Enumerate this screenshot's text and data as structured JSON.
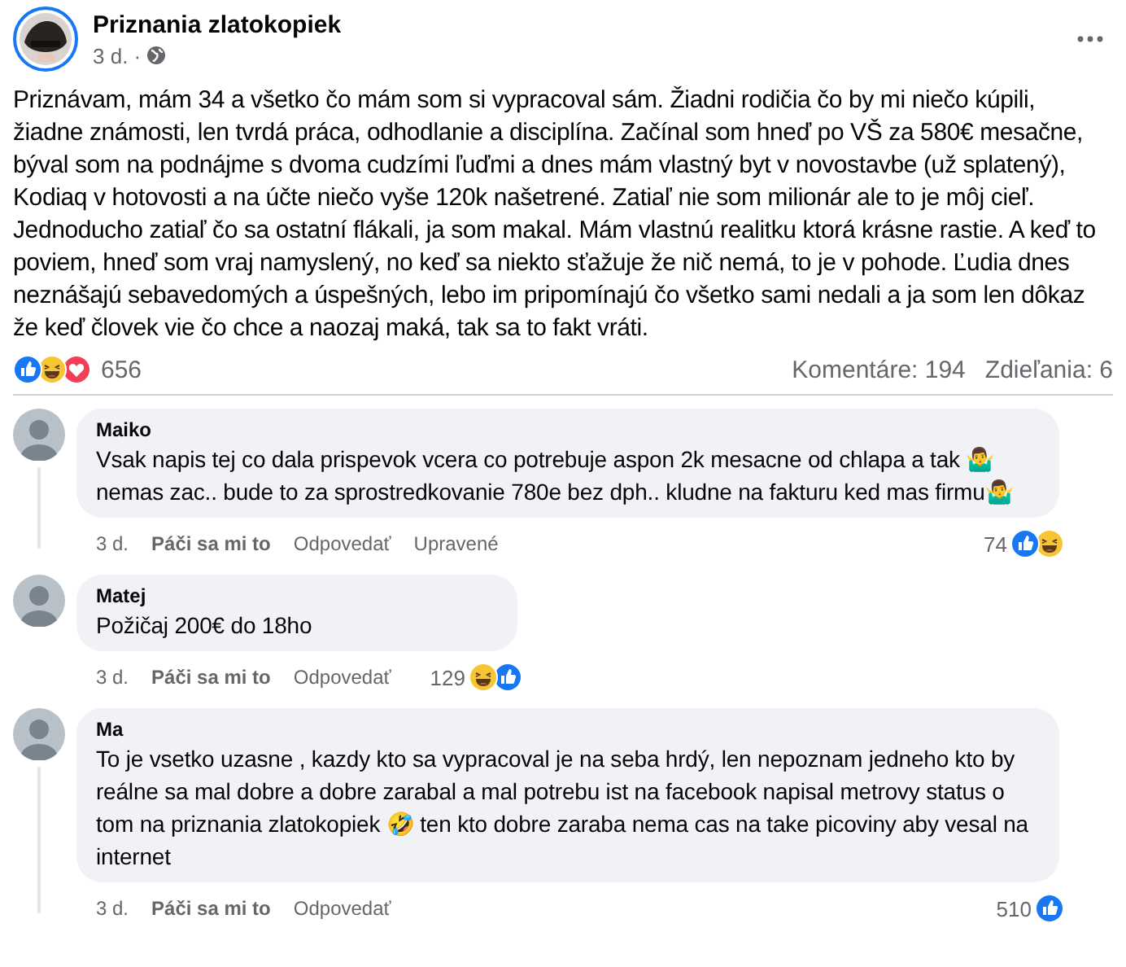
{
  "post": {
    "author": "Priznania zlatokopiek",
    "time": "3 d. ·",
    "text": "Priznávam, mám 34 a všetko čo mám som si vypracoval sám. Žiadni rodičia čo by mi niečo kúpili, žiadne známosti, len tvrdá práca, odhodlanie a disciplína. Začínal som hneď po VŠ za 580€ mesačne, býval som na podnájme s dvoma cudzími ľuďmi a dnes mám vlastný byt v novostavbe (už splatený), Kodiaq v hotovosti a na účte niečo vyše 120k našetrené. Zatiaľ nie som milionár ale to je môj cieľ. Jednoducho zatiaľ čo sa ostatní flákali, ja som makal. Mám vlastnú realitku ktorá krásne rastie. A keď to poviem, hneď som vraj namyslený, no keď sa niekto sťažuje že nič nemá, to je v pohode. Ľudia dnes neznášajú sebavedomých a úspešných, lebo im pripomínajú čo všetko sami nedali a ja som len dôkaz že keď človek vie čo chce a naozaj maká, tak sa to fakt vráti.",
    "reactions": [
      {
        "kind": "like"
      },
      {
        "kind": "haha"
      },
      {
        "kind": "love"
      }
    ],
    "reaction_count": "656",
    "comments_count": "Komentáre: 194",
    "shares_count": "Zdieľania: 6"
  },
  "comments": [
    {
      "author": "Maiko",
      "text": "Vsak napis tej co dala prispevok vcera co potrebuje aspon 2k mesacne od chlapa a tak 🤷‍♂️ nemas zac.. bude to za sprostredkovanie 780e bez dph.. kludne na fakturu ked mas firmu🤷‍♂️",
      "time": "3 d.",
      "like": "Páči sa mi to",
      "reply": "Odpovedať",
      "edited": "Upravené",
      "count": "74",
      "reactions": [
        {
          "kind": "like"
        },
        {
          "kind": "haha"
        }
      ],
      "has_replies": true
    },
    {
      "author": "Matej",
      "text": "Požičaj 200€ do 18ho",
      "time": "3 d.",
      "like": "Páči sa mi to",
      "reply": "Odpovedať",
      "count": "129",
      "reactions": [
        {
          "kind": "haha"
        },
        {
          "kind": "like"
        }
      ],
      "has_replies": false
    },
    {
      "author": "Ma",
      "text": "To je vsetko uzasne , kazdy kto sa vypracoval je na seba hrdý, len nepoznam jedneho kto by reálne sa mal dobre a dobre zarabal a mal potrebu ist na facebook napisal metrovy status o tom na priznania zlatokopiek 🤣 ten kto dobre zaraba nema cas na take picoviny aby vesal na internet",
      "time": "3 d.",
      "like": "Páči sa mi to",
      "reply": "Odpovedať",
      "count": "510",
      "reactions": [
        {
          "kind": "like"
        }
      ],
      "has_replies": true
    }
  ]
}
